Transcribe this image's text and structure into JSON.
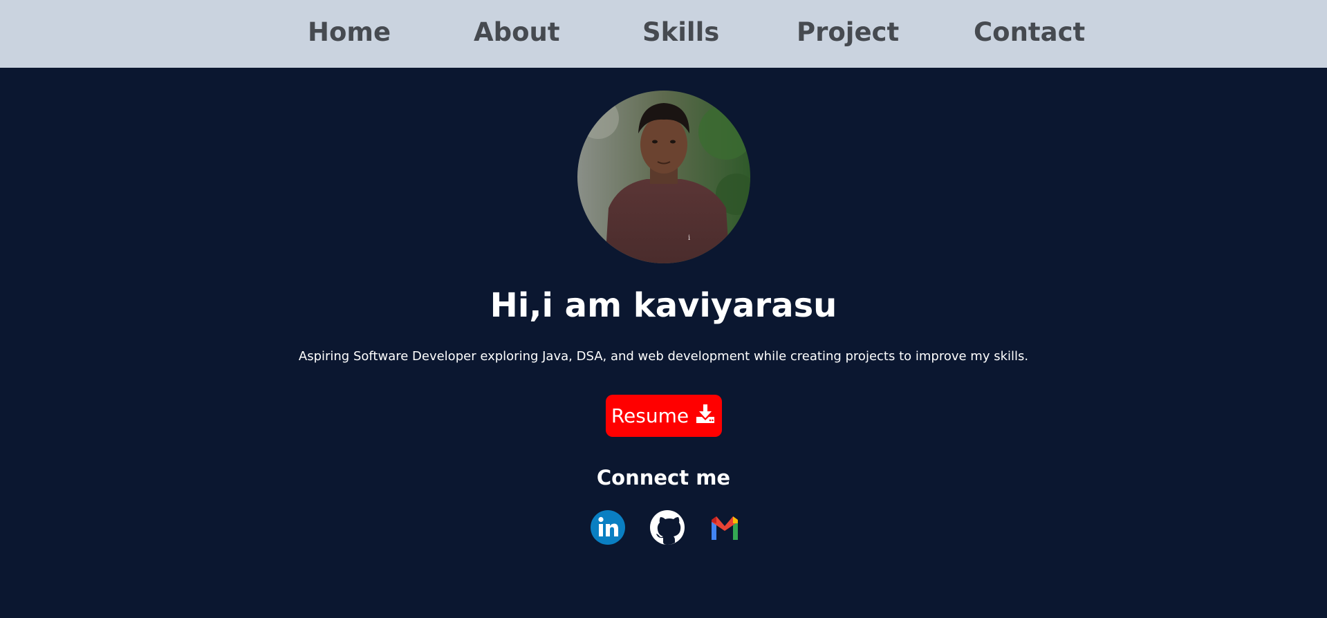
{
  "nav": {
    "items": [
      {
        "label": "Home"
      },
      {
        "label": "About"
      },
      {
        "label": "Skills"
      },
      {
        "label": "Project"
      },
      {
        "label": "Contact"
      }
    ]
  },
  "hero": {
    "heading": "Hi,i am kaviyarasu",
    "tagline": "Aspiring Software Developer exploring Java, DSA, and web development while creating projects to improve my skills.",
    "resume_label": "Resume",
    "resume_icon": "download-icon",
    "connect_heading": "Connect me",
    "socials": [
      {
        "icon": "linkedin-icon"
      },
      {
        "icon": "github-icon"
      },
      {
        "icon": "gmail-icon"
      }
    ]
  },
  "colors": {
    "nav_bg": "#cad3df",
    "nav_text": "#464a50",
    "page_bg": "#0b1730",
    "button_bg": "#ff0000",
    "text": "#ffffff"
  }
}
